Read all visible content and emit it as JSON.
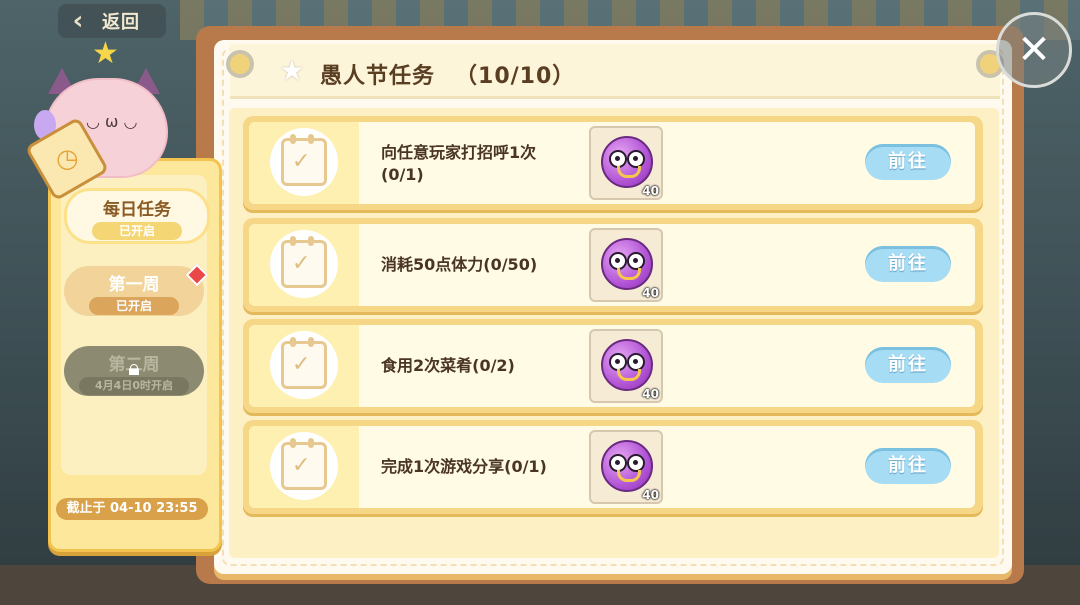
{
  "header": {
    "back_label": "返回"
  },
  "sidebar": {
    "tabs": [
      {
        "label": "每日任务",
        "status": "已开启"
      },
      {
        "label": "第一周",
        "status": "已开启"
      },
      {
        "label": "第二周",
        "status": "4月4日0时开启"
      }
    ],
    "deadline": "截止于 04-10 23:55"
  },
  "panel": {
    "title": "愚人节任务",
    "progress": "（10/10）"
  },
  "tasks": [
    {
      "desc_line1": "向任意玩家打招呼1次",
      "desc_line2": "(0/1)",
      "reward_qty": "40",
      "button": "前往"
    },
    {
      "desc_line1": "消耗50点体力(0/50)",
      "reward_qty": "40",
      "button": "前往"
    },
    {
      "desc_line1": "食用2次菜肴(0/2)",
      "reward_qty": "40",
      "button": "前往"
    },
    {
      "desc_line1": "完成1次游戏分享(0/1)",
      "reward_qty": "40",
      "button": "前往"
    }
  ],
  "icons": {
    "back": "chevron-left-icon",
    "close": "close-icon",
    "title": "star-icon",
    "task": "calendar-check-icon",
    "reward": "purple-ball-icon",
    "lock": "lock-icon"
  },
  "colors": {
    "accent_yellow": "#fde79a",
    "button_blue": "#a6dcf4",
    "title_brown": "#5a3e22",
    "notify_red": "#e84848"
  }
}
